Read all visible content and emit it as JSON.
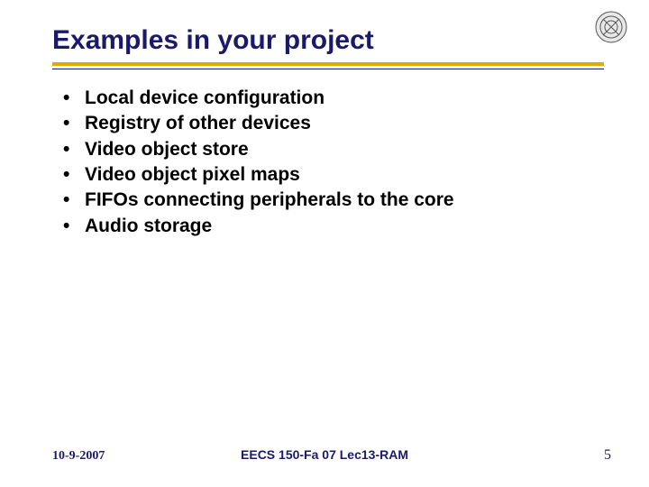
{
  "title": "Examples in your project",
  "bullets": {
    "b0": "Local device configuration",
    "b1": "Registry of other devices",
    "b2": "Video object store",
    "b3": "Video object pixel maps",
    "b4": "FIFOs connecting peripherals to the core",
    "b5": "Audio storage"
  },
  "footer": {
    "date": "10-9-2007",
    "course": "EECS 150-Fa 07 Lec13-RAM",
    "page": "5"
  },
  "icon": {
    "name": "seal-icon"
  },
  "colors": {
    "title": "#1a1a6a",
    "rule_thick": "#e6a800",
    "rule_thin": "#1a1a6a",
    "footer": "#1a1a6a"
  }
}
